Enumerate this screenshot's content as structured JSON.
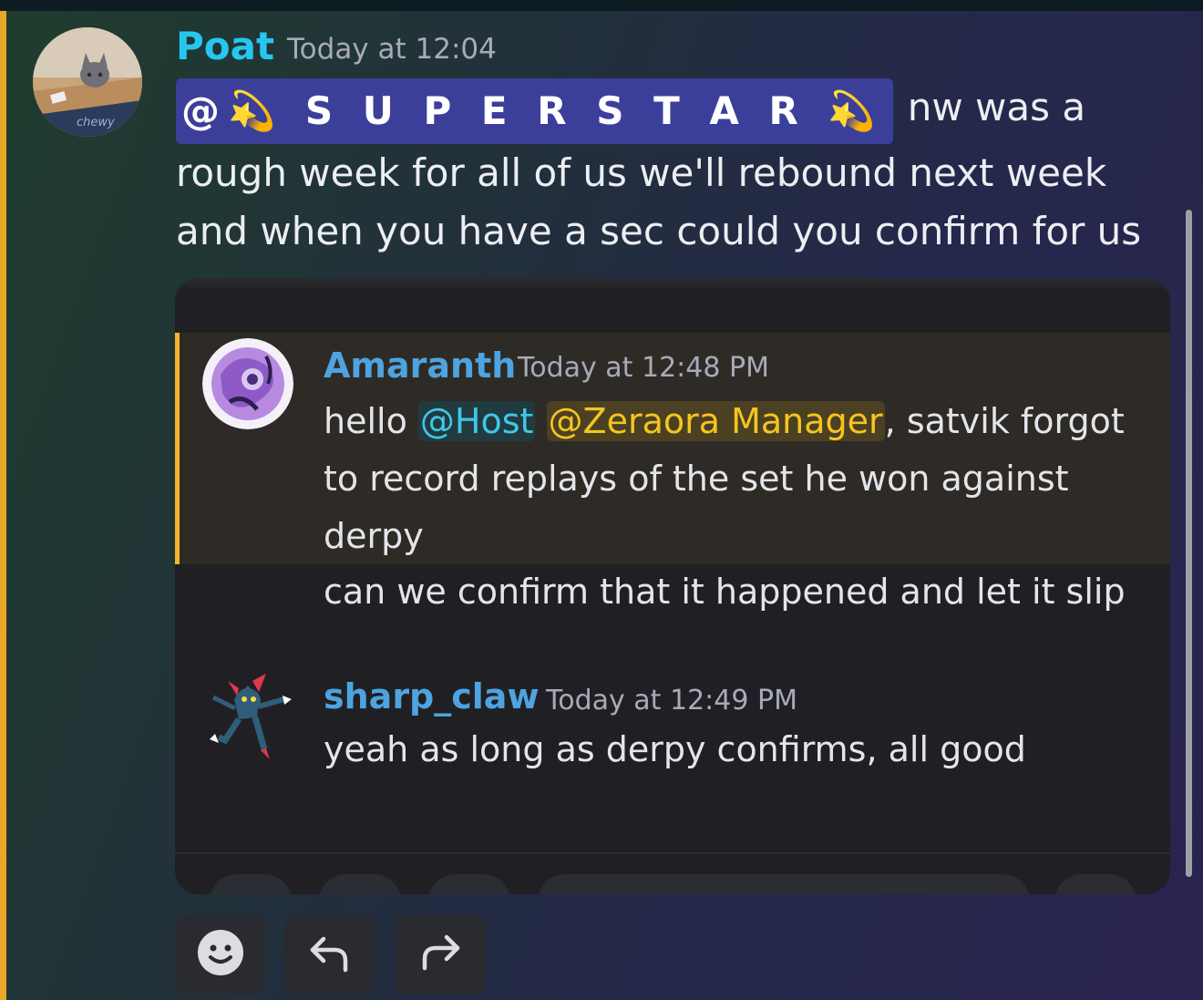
{
  "message": {
    "author": "Poat",
    "timestamp": "Today at 12:04",
    "mention": "@💫 S U P E R S T A R 💫",
    "text": "nw was a rough week for all of us we'll rebound next week and when you have a sec could you confirm for us"
  },
  "embed": {
    "quoted": {
      "author": "Amaranth",
      "timestamp": "Today at 12:48 PM",
      "text_prefix": "hello ",
      "mention_host": "@Host",
      "mention_zeraora": "@Zeraora Manager",
      "text_suffix": ", satvik forgot to record replays of the set he won against derpy"
    },
    "followup": "can we confirm that it happened and let it slip",
    "reply": {
      "author": "sharp_claw",
      "timestamp": "Today at 12:49 PM",
      "text": "yeah as long as derpy confirms, all good"
    }
  },
  "actions": {
    "react_icon": "smiley-icon",
    "reply_icon": "reply-arrow-icon",
    "forward_icon": "forward-arrow-icon"
  },
  "colors": {
    "author": "#26c7ef",
    "highlight_bar": "#e9a825",
    "role_mention_bg": "#3c3f9a",
    "host_mention": "#3fc7e6",
    "zeraora_mention": "#f5c51f"
  }
}
